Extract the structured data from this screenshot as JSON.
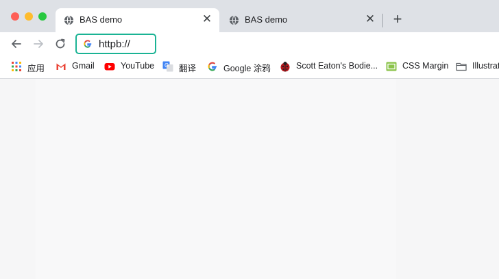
{
  "tabs": [
    {
      "title": "BAS demo",
      "favicon": "globe-icon",
      "active": true
    },
    {
      "title": "BAS demo",
      "favicon": "globe-icon",
      "active": false
    }
  ],
  "toolbar": {
    "address_value": "httpb://"
  },
  "bookmarks": [
    {
      "label": "应用",
      "icon": "apps-grid-icon"
    },
    {
      "label": "Gmail",
      "icon": "gmail-icon"
    },
    {
      "label": "YouTube",
      "icon": "youtube-icon"
    },
    {
      "label": "翻译",
      "icon": "translate-icon"
    },
    {
      "label": "Google 涂鸦",
      "icon": "google-icon"
    },
    {
      "label": "Scott Eaton's Bodie...",
      "icon": "ladybug-icon"
    },
    {
      "label": "CSS Margin",
      "icon": "css-icon"
    },
    {
      "label": "Illustrat",
      "icon": "folder-icon"
    }
  ],
  "colors": {
    "omnibox_focus": "#1ab394",
    "tabstrip": "#dee1e6",
    "content_bg": "#f6f6f7"
  }
}
